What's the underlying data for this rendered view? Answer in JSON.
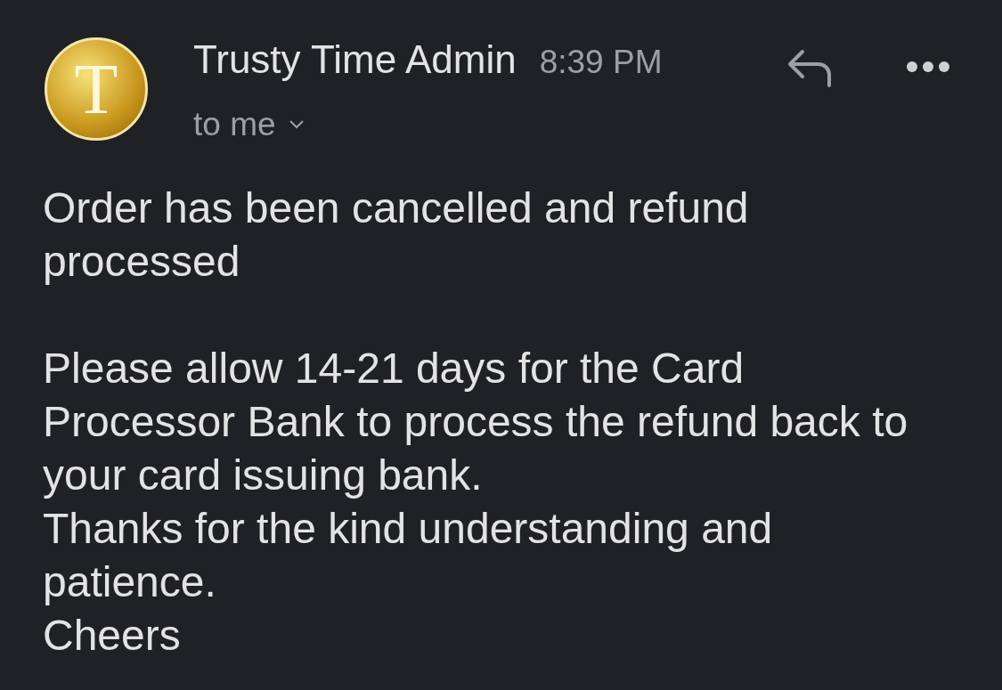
{
  "sender": {
    "avatar_letter": "T",
    "name": "Trusty Time Admin",
    "time": "8:39 PM",
    "recipient": "to me"
  },
  "body": [
    {
      "lines": [
        "Order has been cancelled and refund processed"
      ]
    },
    {
      "lines": [
        "Please allow 14-21 days for the Card Processor Bank to process the refund back to your card issuing bank.",
        "Thanks for the kind understanding and patience.",
        "Cheers"
      ]
    }
  ]
}
